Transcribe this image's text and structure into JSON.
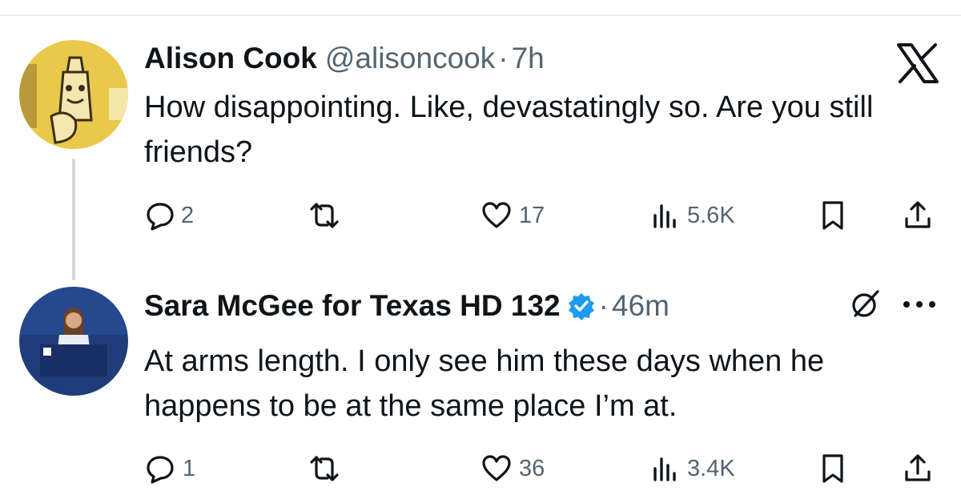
{
  "tweets": [
    {
      "author_name": "Alison Cook",
      "handle": "@alisoncook",
      "separator": "·",
      "time": "7h",
      "text": "How disappointing. Like, devastatingly so. Are you still friends?",
      "stats": {
        "replies": "2",
        "retweets": "",
        "likes": "17",
        "views": "5.6K"
      }
    },
    {
      "author_name": "Sara McGee for Texas HD 132",
      "verified": true,
      "separator": "·",
      "time": "46m",
      "text": "At arms length. I only see him these days when he happens to be at the same place I’m at.",
      "stats": {
        "replies": "1",
        "retweets": "",
        "likes": "36",
        "views": "3.4K"
      }
    }
  ],
  "colors": {
    "text_primary": "#0f1419",
    "text_secondary": "#536471",
    "verified_blue": "#1d9bf0",
    "thread_line": "#cfd9de"
  },
  "icons": {
    "brand": "x-logo-icon",
    "more": "more-horizontal-icon",
    "grok": "grok-icon",
    "reply": "reply-icon",
    "retweet": "retweet-icon",
    "like": "heart-icon",
    "views": "views-chart-icon",
    "bookmark": "bookmark-icon",
    "share": "share-icon"
  }
}
